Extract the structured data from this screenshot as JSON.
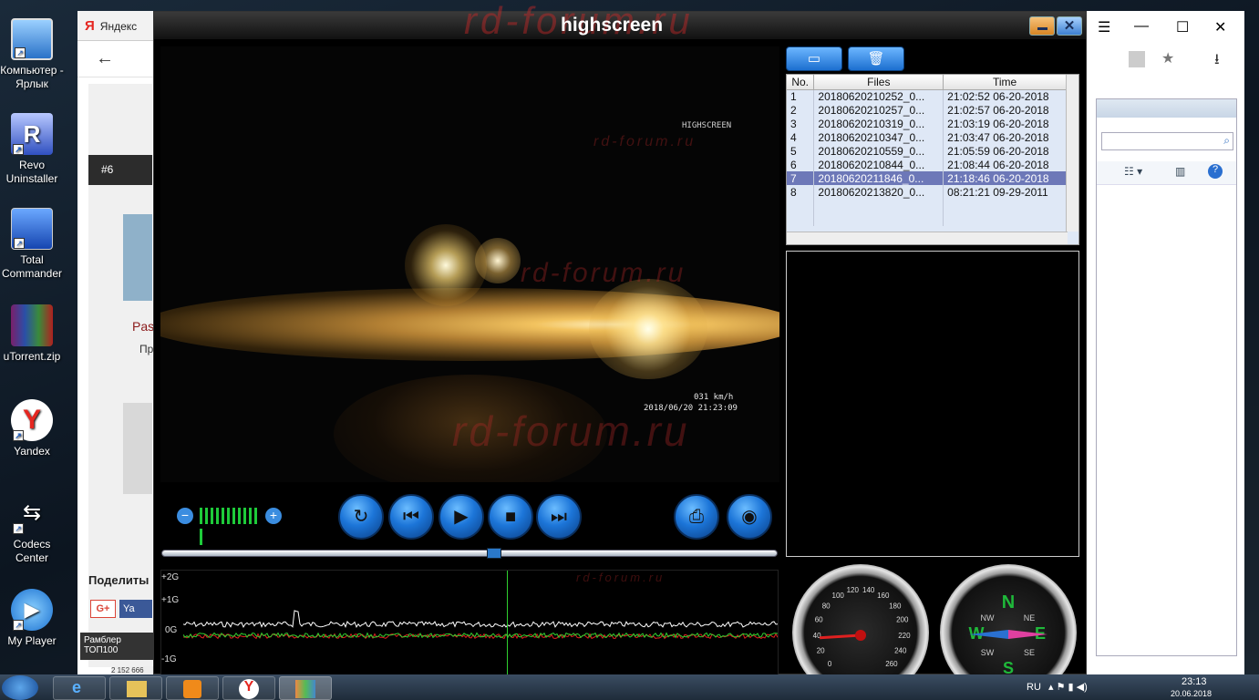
{
  "desktop": {
    "icons": [
      {
        "label": "Компьютер - Ярлык",
        "icon": "computer-icon"
      },
      {
        "label": "Revo Uninstaller",
        "icon": "revo-uninstaller-icon"
      },
      {
        "label": "Total Commander",
        "icon": "total-commander-icon"
      },
      {
        "label": "uTorrent.zip",
        "icon": "winrar-archive-icon"
      },
      {
        "label": "Yandex",
        "icon": "yandex-browser-icon"
      },
      {
        "label": "Codecs Center",
        "icon": "codecs-center-icon"
      },
      {
        "label": "My Player",
        "icon": "my-player-icon"
      }
    ]
  },
  "browser": {
    "tab_title": "Яндекс",
    "tab_icon": "Я",
    "forum": {
      "post_number": "#6",
      "user_name": "Pas",
      "user_text": "Пр",
      "share_label": "Поделиты",
      "gplus": "G+",
      "fb": "Ya"
    },
    "rambler": {
      "line1": "Рамблер",
      "line2": "ТОП100"
    },
    "counter": "2 152 666"
  },
  "app": {
    "title_logo": "highscreen",
    "title_watermark": "rd-forum.ru",
    "video": {
      "brand": "HIGHSCREEN",
      "watermark_small": "rd-forum.ru",
      "watermark_mid": "rd-forum.ru",
      "watermark_big": "rd-forum.ru",
      "speed": "031 km/h",
      "datetime": "2018/06/20 21:23:09"
    },
    "graph": {
      "labels": [
        "+2G",
        "+1G",
        "0G",
        "-1G"
      ],
      "watermark": "rd-forum.ru",
      "cursor_position": 0.56
    },
    "seek": {
      "progress": 0.54
    },
    "volume": {
      "level_bars": 12,
      "minus": "−",
      "plus": "+"
    },
    "controls": {
      "repeat": "repeat-icon",
      "prev": "skip-back-icon",
      "play": "play-icon",
      "stop": "stop-icon",
      "next": "skip-forward-icon",
      "print": "printer-icon",
      "snapshot": "camera-icon"
    },
    "filelist": {
      "headers": [
        "No.",
        "Files",
        "Time"
      ],
      "rows": [
        {
          "no": "1",
          "file": "20180620210252_0...",
          "time": "21:02:52 06-20-2018"
        },
        {
          "no": "2",
          "file": "20180620210257_0...",
          "time": "21:02:57 06-20-2018"
        },
        {
          "no": "3",
          "file": "20180620210319_0...",
          "time": "21:03:19 06-20-2018"
        },
        {
          "no": "4",
          "file": "20180620210347_0...",
          "time": "21:03:47 06-20-2018"
        },
        {
          "no": "5",
          "file": "20180620210559_0...",
          "time": "21:05:59 06-20-2018"
        },
        {
          "no": "6",
          "file": "20180620210844_0...",
          "time": "21:08:44 06-20-2018"
        },
        {
          "no": "7",
          "file": "20180620211846_0...",
          "time": "21:18:46 06-20-2018"
        },
        {
          "no": "8",
          "file": "20180620213820_0...",
          "time": "08:21:21 09-29-2011"
        }
      ],
      "selected_row": "7"
    },
    "speedometer": {
      "ticks": [
        "0",
        "20",
        "40",
        "60",
        "80",
        "100",
        "120",
        "140",
        "160",
        "180",
        "200",
        "220",
        "240",
        "260"
      ],
      "value": 40
    },
    "compass": {
      "n": "N",
      "e": "E",
      "s": "S",
      "w": "W",
      "ne": "NE",
      "nw": "NW",
      "se": "SE",
      "sw": "SW"
    }
  },
  "taskbar": {
    "lang": "RU",
    "time": "23:13",
    "date": "20.06.2018"
  },
  "colors": {
    "accent_blue": "#1c75d8",
    "graph_x": "#ffffff",
    "graph_y": "#2fd02f",
    "graph_z": "#e02020",
    "selected_row": "#6d78b8"
  }
}
